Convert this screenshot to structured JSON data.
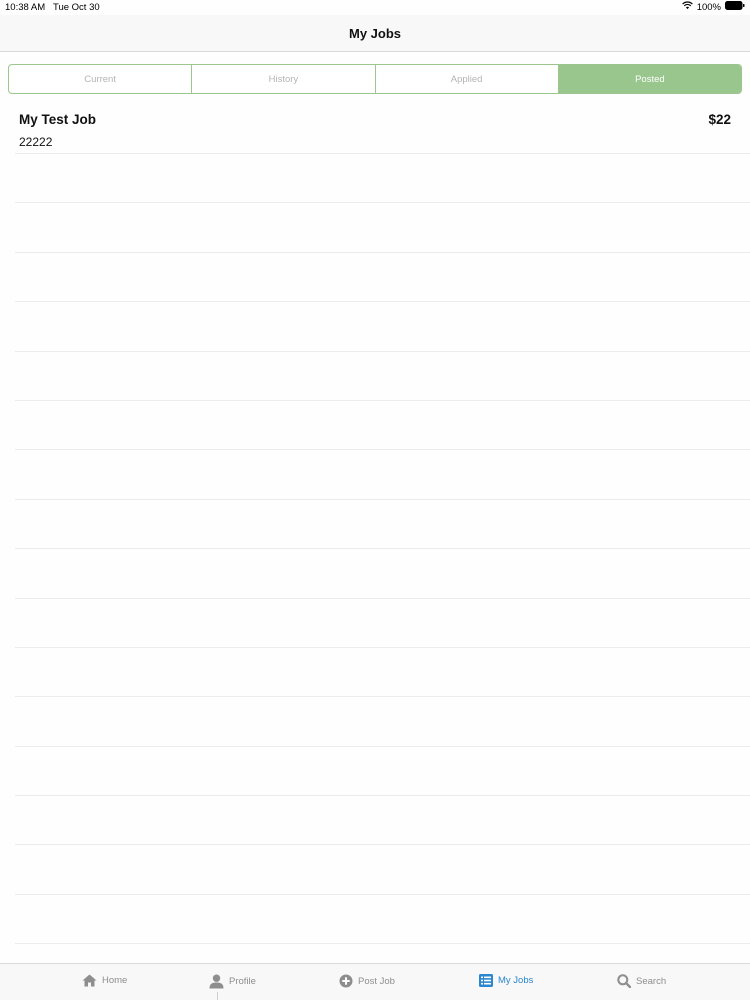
{
  "status_bar": {
    "time": "10:38 AM",
    "date": "Tue Oct 30",
    "battery": "100%",
    "icons": [
      "wifi-icon",
      "battery-icon"
    ]
  },
  "nav": {
    "title": "My Jobs"
  },
  "segments": {
    "items": [
      "Current",
      "History",
      "Applied",
      "Posted"
    ],
    "selected": "Posted"
  },
  "jobs": [
    {
      "title": "My Test Job",
      "subtitle": "22222",
      "price": "$22"
    }
  ],
  "tabs": {
    "home": "Home",
    "profile": "Profile",
    "post_job": "Post Job",
    "my_jobs": "My Jobs",
    "search": "Search",
    "active": "My Jobs"
  },
  "colors": {
    "accent_green": "#99c68c",
    "tab_active_blue": "#2a87d0",
    "tab_inactive_gray": "#8e8e8e"
  }
}
